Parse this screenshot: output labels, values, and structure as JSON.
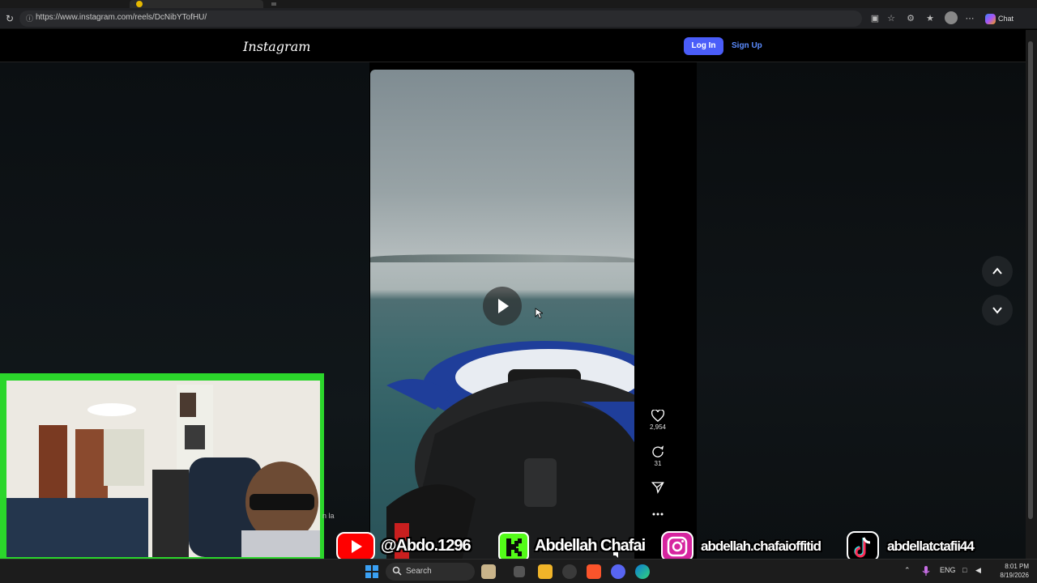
{
  "browser": {
    "url": "https://www.instagram.com/reels/DcNibYTofHU/",
    "chat_label": "Chat"
  },
  "header": {
    "logo_text": "Instagram",
    "login_label": "Log In",
    "signup_label": "Sign Up"
  },
  "reel": {
    "likes": "2,954",
    "comments": "31"
  },
  "webcam": {
    "caption_fragment": "n la"
  },
  "overlay": {
    "youtube_handle": "@Abdo.1296",
    "kick_name": "Abdellah Chafai",
    "instagram_handle": "abdellah.chafaioffitid",
    "tiktok_handle": "abdellatctafii44"
  },
  "taskbar": {
    "search_label": "Search",
    "language": "ENG",
    "time": "8:01 PM",
    "date": "8/19/2026"
  },
  "colors": {
    "login_button": "#4a5df9",
    "signup_link": "#5b8cff",
    "webcam_frame": "#2bd62b"
  }
}
